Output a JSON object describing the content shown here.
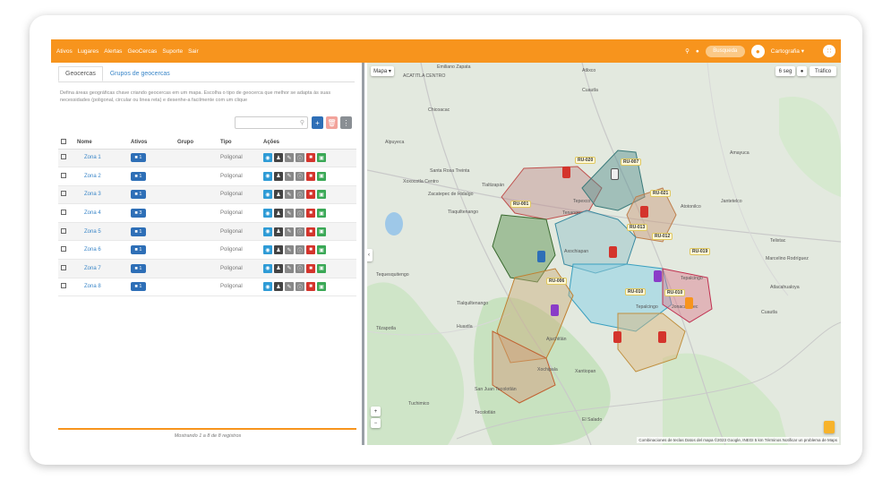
{
  "nav": [
    "Ativos",
    "Lugares",
    "Alertas",
    "GeoCercas",
    "Suporte",
    "Sair"
  ],
  "topbar": {
    "search_label": "Busqueda",
    "user_label": "Cartografia ▾"
  },
  "tabs": [
    "Geocercas",
    "Grupos de geocercas"
  ],
  "description": "Defina áreas geográficas chave criando geocercas em um mapa. Escolha o tipo de geocerca que melhor se adapta às suas necessidades (poligonal, circular ou linea reta) e desenhe-a facilmente com um clique",
  "table": {
    "headers": [
      "Nome",
      "Ativos",
      "Grupo",
      "Tipo",
      "Ações"
    ],
    "rows": [
      {
        "name": "Zona 1",
        "assets": "1",
        "type": "Poligonal"
      },
      {
        "name": "Zona 2",
        "assets": "1",
        "type": "Poligonal"
      },
      {
        "name": "Zona 3",
        "assets": "1",
        "type": "Poligonal"
      },
      {
        "name": "Zona 4",
        "assets": "3",
        "type": "Poligonal"
      },
      {
        "name": "Zona 5",
        "assets": "1",
        "type": "Poligonal"
      },
      {
        "name": "Zona 6",
        "assets": "1",
        "type": "Poligonal"
      },
      {
        "name": "Zona 7",
        "assets": "1",
        "type": "Poligonal"
      },
      {
        "name": "Zona 8",
        "assets": "1",
        "type": "Poligonal"
      }
    ]
  },
  "footer": "Mostrando 1 a 8 de 8 registros",
  "map": {
    "type_label": "Mapa ▾",
    "refresh_label": "6 seg",
    "traffic_label": "Tráfico",
    "zone_tags": [
      "RU-020",
      "RU-007",
      "RU-021",
      "RU-001",
      "RU-013",
      "RU-012",
      "RU-019",
      "RU-006",
      "RU-010",
      "RU-010"
    ],
    "places": [
      "Emiliano Zapata",
      "ACATITLA CENTRO",
      "Atlixco",
      "Cuautla",
      "Chicoacac",
      "Alpuyeca",
      "Santa Rosa Treinta",
      "Xoxocotla Centro",
      "Zacatepec de Hidalgo",
      "Tlaquiltenango",
      "Tlaltizapán",
      "Tequesquitengo",
      "Tepalcingo",
      "Tlalquiltenango",
      "Tilzapotla",
      "Huaxtla",
      "Ajuchitlán",
      "Xantiopan",
      "Xochipala",
      "San Juan Tecolotlán",
      "Tuchimico",
      "Tecolotlán",
      "El Salado",
      "Axochiapan",
      "Tepexco",
      "Tenango",
      "Tepalcingo",
      "Jonacatepec",
      "Atotonilco",
      "Amayuca",
      "Jantetelco",
      "Telixtac",
      "Marcelino Rodríguez",
      "Atlacahualoya",
      "Cuautla"
    ],
    "attribution": "Combinaciones de teclas   Datos del mapa ©2023 Google, INEGI   5 km   Términos   Notificar un problema de Maps",
    "zoom_in": "+",
    "zoom_out": "−"
  },
  "colors": {
    "accent": "#f7941d",
    "link": "#3a86c8",
    "badge": "#2e6fb7"
  }
}
